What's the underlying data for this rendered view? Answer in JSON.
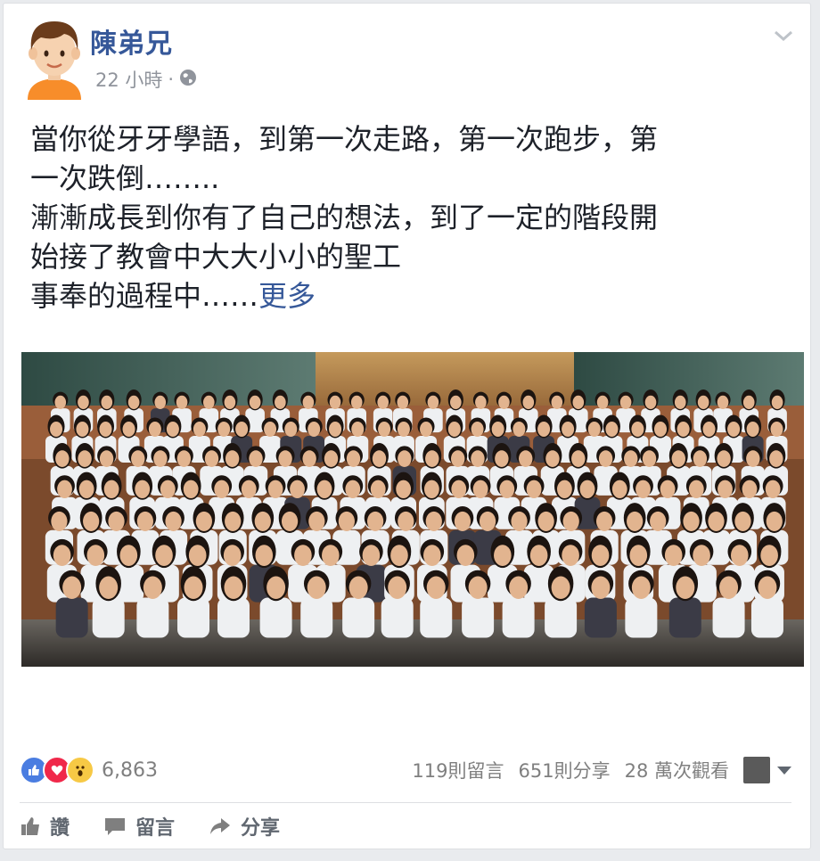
{
  "post": {
    "author": "陳弟兄",
    "time": "22 小時",
    "separator": "·",
    "privacy_icon": "globe-icon",
    "lines": [
      "當你從牙牙學語，到第一次走路，第一次跑步，第",
      "一次跌倒……..",
      "漸漸成長到你有了自己的想法，到了一定的階段開",
      "始接了教會中大大小小的聖工"
    ],
    "last_line": "事奉的過程中……",
    "more_link": "更多"
  },
  "stats": {
    "reaction_icons": [
      "like-icon",
      "love-icon",
      "wow-icon"
    ],
    "reaction_count": "6,863",
    "comments": "119則留言",
    "shares": "651則分享",
    "views": "28 萬次觀看"
  },
  "actions": {
    "like": "讚",
    "comment": "留言",
    "share": "分享"
  },
  "colors": {
    "link": "#365899",
    "text": "#1d2129",
    "muted": "#90949c",
    "like": "#4a7de1",
    "love": "#f0284a",
    "wow": "#f7c945"
  }
}
